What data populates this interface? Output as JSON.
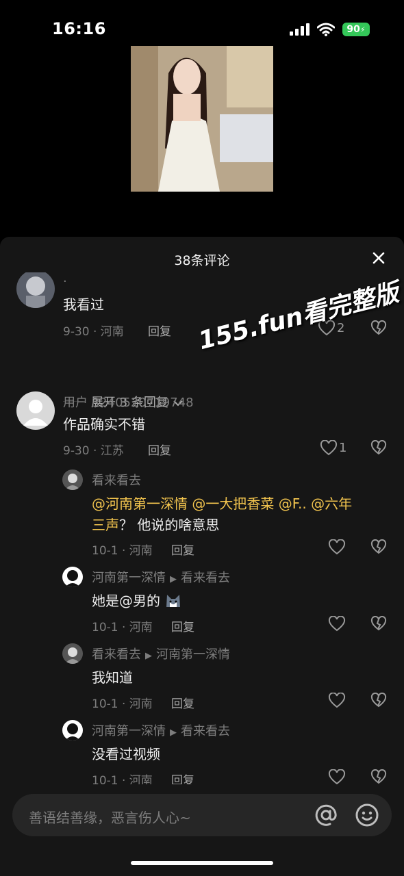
{
  "status": {
    "time": "16:16",
    "battery": "90"
  },
  "sheet": {
    "title": "38条评论"
  },
  "comments": [
    {
      "username": ".",
      "text": "我看过",
      "date_location": "9-30 · 河南",
      "reply": "回复",
      "likes": "2",
      "expand": "展开 3 条回复"
    },
    {
      "username": "用户 3240520719748",
      "text": "作品确实不错",
      "date_location": "9-30 · 江苏",
      "reply": "回复",
      "likes": "1"
    }
  ],
  "replies": [
    {
      "username": "看来看去",
      "mentions": [
        "@河南第一深情",
        "@一大把香菜",
        "@F..",
        "@六年"
      ],
      "mention_cont": "三声",
      "text_tail": "？ 他说的啥意思",
      "date_location": "10-1 · 河南",
      "reply": "回复"
    },
    {
      "username": "河南第一深情",
      "reply_to": "看来看去",
      "text": "她是@男的",
      "date_location": "10-1 · 河南",
      "reply": "回复"
    },
    {
      "username": "看来看去",
      "reply_to": "河南第一深情",
      "text": "我知道",
      "date_location": "10-1 · 河南",
      "reply": "回复"
    },
    {
      "username": "河南第一深情",
      "reply_to": "看来看去",
      "text": "没看过视频",
      "date_location": "10-1 · 河南",
      "reply": "回复"
    }
  ],
  "watermark": "155.fun看完整版",
  "input": {
    "placeholder": "善语结善缘，恶言伤人心~"
  },
  "icons": [
    "signal-icon",
    "wifi-icon",
    "battery-icon",
    "close-icon",
    "heart-icon",
    "dislike-icon",
    "chevron-down-icon",
    "at-icon",
    "emoji-icon"
  ],
  "colors": {
    "mention": "#f2c44e",
    "battery": "#34c759",
    "sheet_bg": "#161616"
  }
}
